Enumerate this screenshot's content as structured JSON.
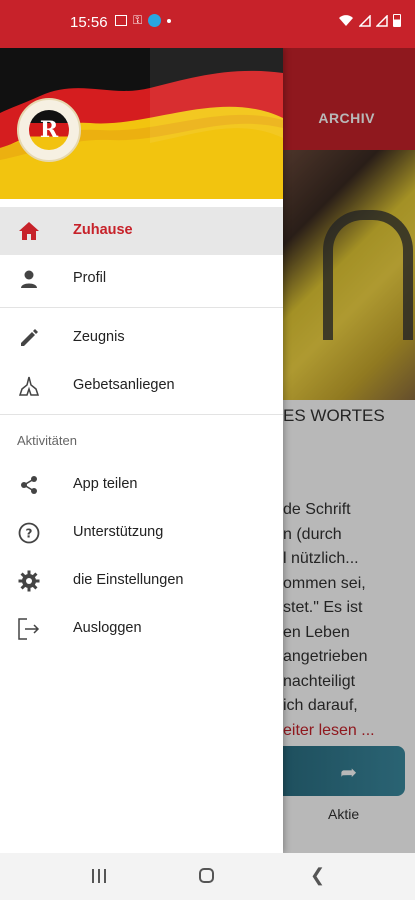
{
  "status_bar": {
    "time": "15:56"
  },
  "background": {
    "tab_label": "ARCHIV",
    "headline": "ES WORTES",
    "paragraph": [
      "de Schrift",
      "n (durch",
      "l nützlich...",
      "ommen sei,",
      "stet.\" Es ist",
      "en Leben",
      "angetrieben",
      "nachteiligt",
      "ich darauf,"
    ],
    "read_more": "eiter lesen ...",
    "share_label": "Aktie"
  },
  "drawer": {
    "logo_letter": "R",
    "items_primary": [
      {
        "label": "Zuhause",
        "icon": "home-icon",
        "active": true
      },
      {
        "label": "Profil",
        "icon": "person-icon",
        "active": false
      }
    ],
    "items_secondary": [
      {
        "label": "Zeugnis",
        "icon": "pencil-icon"
      },
      {
        "label": "Gebetsanliegen",
        "icon": "praying-hands-icon"
      }
    ],
    "section_title": "Aktivitäten",
    "items_activities": [
      {
        "label": "App teilen",
        "icon": "share-icon"
      },
      {
        "label": "Unterstützung",
        "icon": "help-icon"
      },
      {
        "label": "die Einstellungen",
        "icon": "gear-icon"
      },
      {
        "label": "Ausloggen",
        "icon": "logout-icon"
      }
    ]
  },
  "colors": {
    "accent": "#c7222a",
    "active_bg": "#e7e7e7"
  }
}
